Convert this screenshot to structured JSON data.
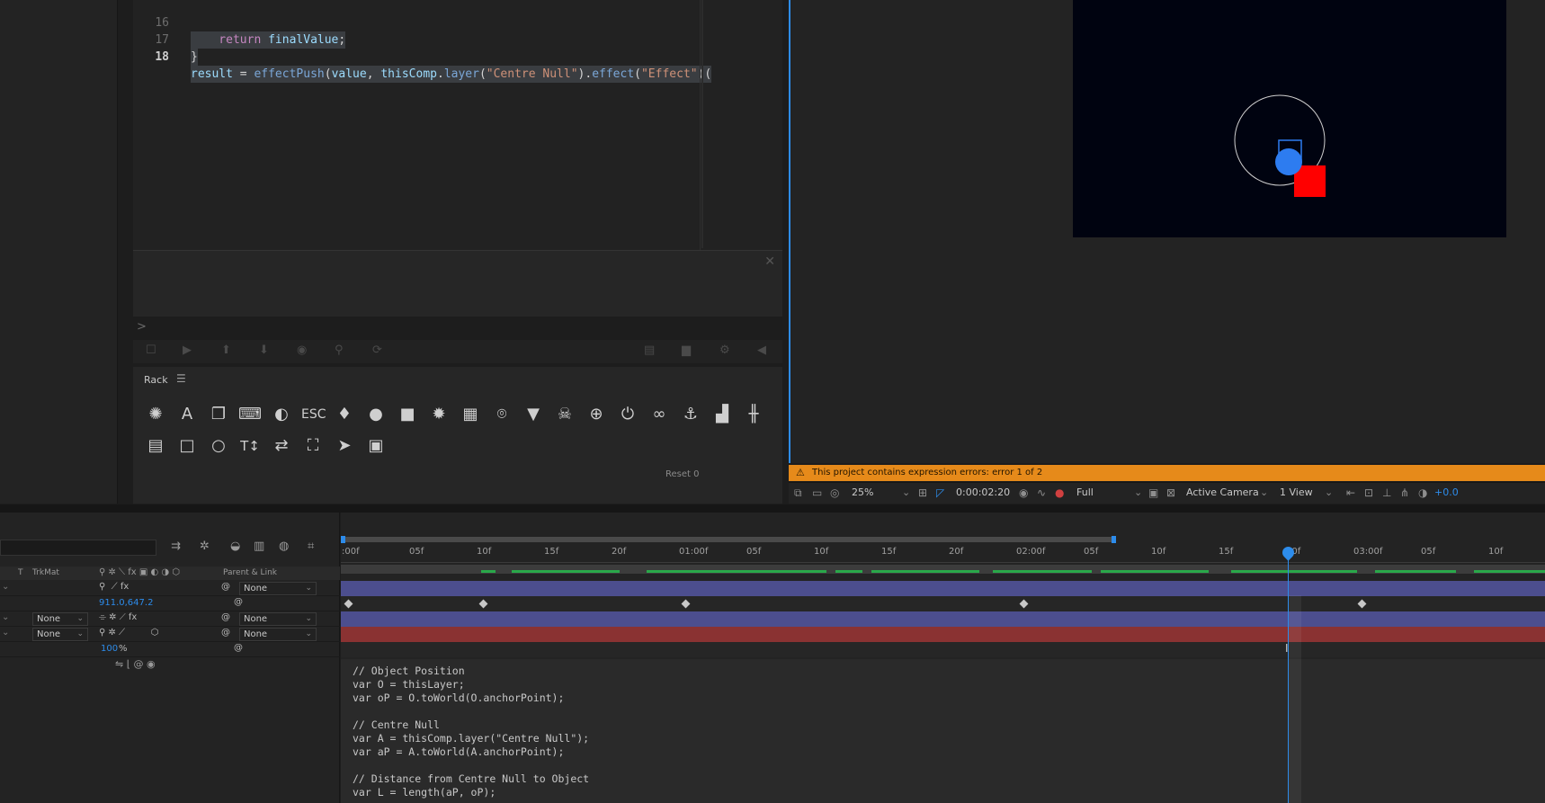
{
  "editor": {
    "lines": [
      {
        "num": "16",
        "text": "    return finalValue;"
      },
      {
        "num": "17",
        "text": "}"
      },
      {
        "num": "18",
        "text": "result = effectPush(value, thisComp.layer(\"Centre Null\").effect(\"Effect\")("
      }
    ]
  },
  "console": {
    "prompt": ">"
  },
  "rack": {
    "title": "Rack",
    "reset_label": "Reset 0",
    "icons_row1": [
      "bug-icon",
      "text-icon",
      "copy-icon",
      "keyboard-icon",
      "contrast-icon",
      "esc-icon",
      "pin-icon",
      "palette-icon",
      "sticky-note-icon",
      "bug-alt-icon",
      "paste-icon",
      "map-marker-icon",
      "filter-icon",
      "skull-icon",
      "crosshair-icon",
      "power-icon",
      "link-icon",
      "anchor-icon",
      "chart-icon",
      "barbell-icon"
    ],
    "icons_row2": [
      "document-icon",
      "square-icon",
      "circle-icon",
      "text-size-icon",
      "swap-icon",
      "transform-icon",
      "pointer-icon",
      "image-file-icon"
    ]
  },
  "viewer": {
    "warning": "This project contains expression errors: error 1 of 2",
    "zoom": "25%",
    "timecode": "0:00:02:20",
    "resolution": "Full",
    "camera": "Active Camera",
    "views": "1 View",
    "exposure": "+0.0",
    "colors": {
      "accent": "#2d8ceb",
      "warning": "#e68a1a",
      "red_layer": "#ff0000",
      "blue_layer": "#2d7cf0"
    }
  },
  "timeline": {
    "header": {
      "t": "T",
      "trkmat": "TrkMat",
      "parent": "Parent & Link"
    },
    "rows": [
      {
        "trkmat": "",
        "parent": "None"
      },
      {
        "value": "911.0,647.2"
      },
      {
        "trkmat": "None",
        "parent": "None"
      },
      {
        "trkmat": "None",
        "parent": "None"
      },
      {
        "value": "100",
        "unit": "%"
      }
    ],
    "ruler": [
      ":00f",
      "05f",
      "10f",
      "15f",
      "20f",
      "01:00f",
      "05f",
      "10f",
      "15f",
      "20f",
      "02:00f",
      "05f",
      "10f",
      "15f",
      "20f",
      "03:00f",
      "05f",
      "10f"
    ],
    "code": [
      "// Object Position",
      "var O = thisLayer;",
      "var oP = O.toWorld(O.anchorPoint);",
      "",
      "// Centre Null",
      "var A = thisComp.layer(\"Centre Null\");",
      "var aP = A.toWorld(A.anchorPoint);",
      "",
      "// Distance from Centre Null to Object",
      "var L = length(aP, oP);"
    ]
  }
}
